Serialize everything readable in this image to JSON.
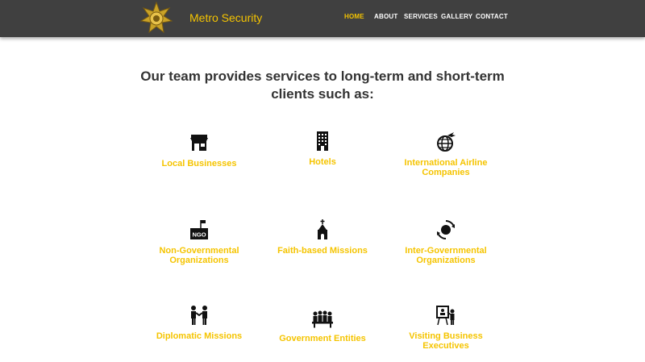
{
  "header": {
    "brand": "Metro Security",
    "logo_icon": "sheriff-star-badge-icon",
    "nav": [
      "HOME",
      "ABOUT",
      "SERVICES",
      "GALLERY",
      "CONTACT"
    ],
    "active_nav": "HOME"
  },
  "main": {
    "heading_line1": "Our team provides services to long-term and short-term",
    "heading_line2": "clients such as:",
    "services": [
      {
        "label_line1": "Local Businesses",
        "label_line2": "",
        "icon": "storefront-icon"
      },
      {
        "label_line1": "Hotels",
        "label_line2": "",
        "icon": "hotel-building-icon"
      },
      {
        "label_line1": "International Airline",
        "label_line2": "Companies",
        "icon": "globe-airplane-icon"
      },
      {
        "label_line1": "Non-Governmental",
        "label_line2": "Organizations",
        "icon": "ngo-flag-icon"
      },
      {
        "label_line1": "Faith-based Missions",
        "label_line2": "",
        "icon": "church-icon"
      },
      {
        "label_line1": "Inter-Governmental",
        "label_line2": "Organizations",
        "icon": "globe-exchange-icon"
      },
      {
        "label_line1": "Diplomatic Missions",
        "label_line2": "",
        "icon": "handshake-people-icon"
      },
      {
        "label_line1": "Government Entities",
        "label_line2": "",
        "icon": "meeting-people-icon"
      },
      {
        "label_line1": "Visiting Business",
        "label_line2": "Executives",
        "icon": "presenter-board-icon"
      }
    ]
  },
  "colors": {
    "accent": "#f5c400",
    "header_bg": "#404040",
    "heading_text": "#333333",
    "icon": "#111111"
  }
}
